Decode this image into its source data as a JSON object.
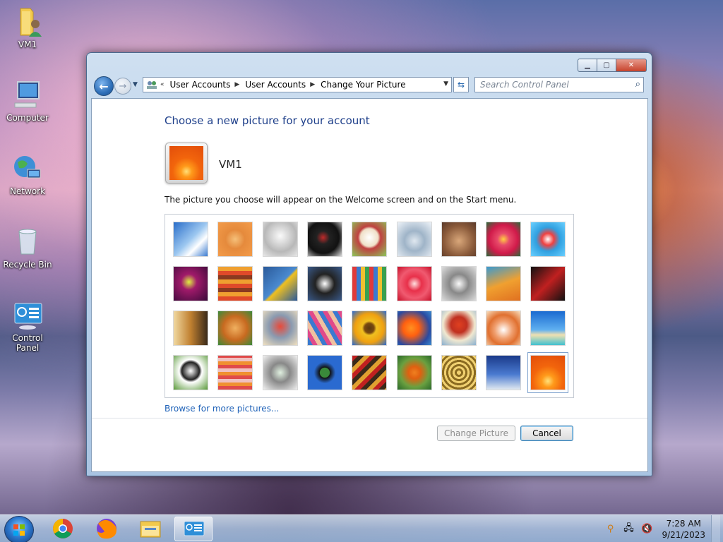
{
  "desktop": {
    "icons": [
      {
        "label": "VM1"
      },
      {
        "label": "Computer"
      },
      {
        "label": "Network"
      },
      {
        "label": "Recycle Bin"
      },
      {
        "label": "Control Panel"
      }
    ]
  },
  "window": {
    "breadcrumb": [
      "User Accounts",
      "User Accounts",
      "Change Your Picture"
    ],
    "breadcrumb_prefix": "«",
    "search_placeholder": "Search Control Panel",
    "heading": "Choose a new picture for your account",
    "account_name": "VM1",
    "description": "The picture you choose will appear on the Welcome screen and on the Start menu.",
    "browse_link": "Browse for more pictures...",
    "change_button": "Change Picture",
    "cancel_button": "Cancel",
    "pictures": [
      "roller coaster",
      "starfish",
      "robot toy",
      "record player",
      "lucky cat",
      "gyroscope",
      "kitten",
      "pink flower",
      "ferris wheel",
      "beach ball",
      "fabric",
      "leaf",
      "dog",
      "crayons",
      "star lantern",
      "jacks",
      "stairs",
      "paper crane",
      "guitar",
      "puppy",
      "robot",
      "shawl",
      "sunflower",
      "fish",
      "hot air balloon",
      "doll",
      "sailboat",
      "soccer ball",
      "textile",
      "marbles",
      "window",
      "rug",
      "butterfly",
      "shell",
      "lighthouse",
      "orange flower"
    ],
    "selected_index": 35
  },
  "taskbar": {
    "time": "7:28 AM",
    "date": "9/21/2023",
    "apps": [
      "chrome",
      "firefox",
      "file explorer",
      "control panel"
    ]
  }
}
